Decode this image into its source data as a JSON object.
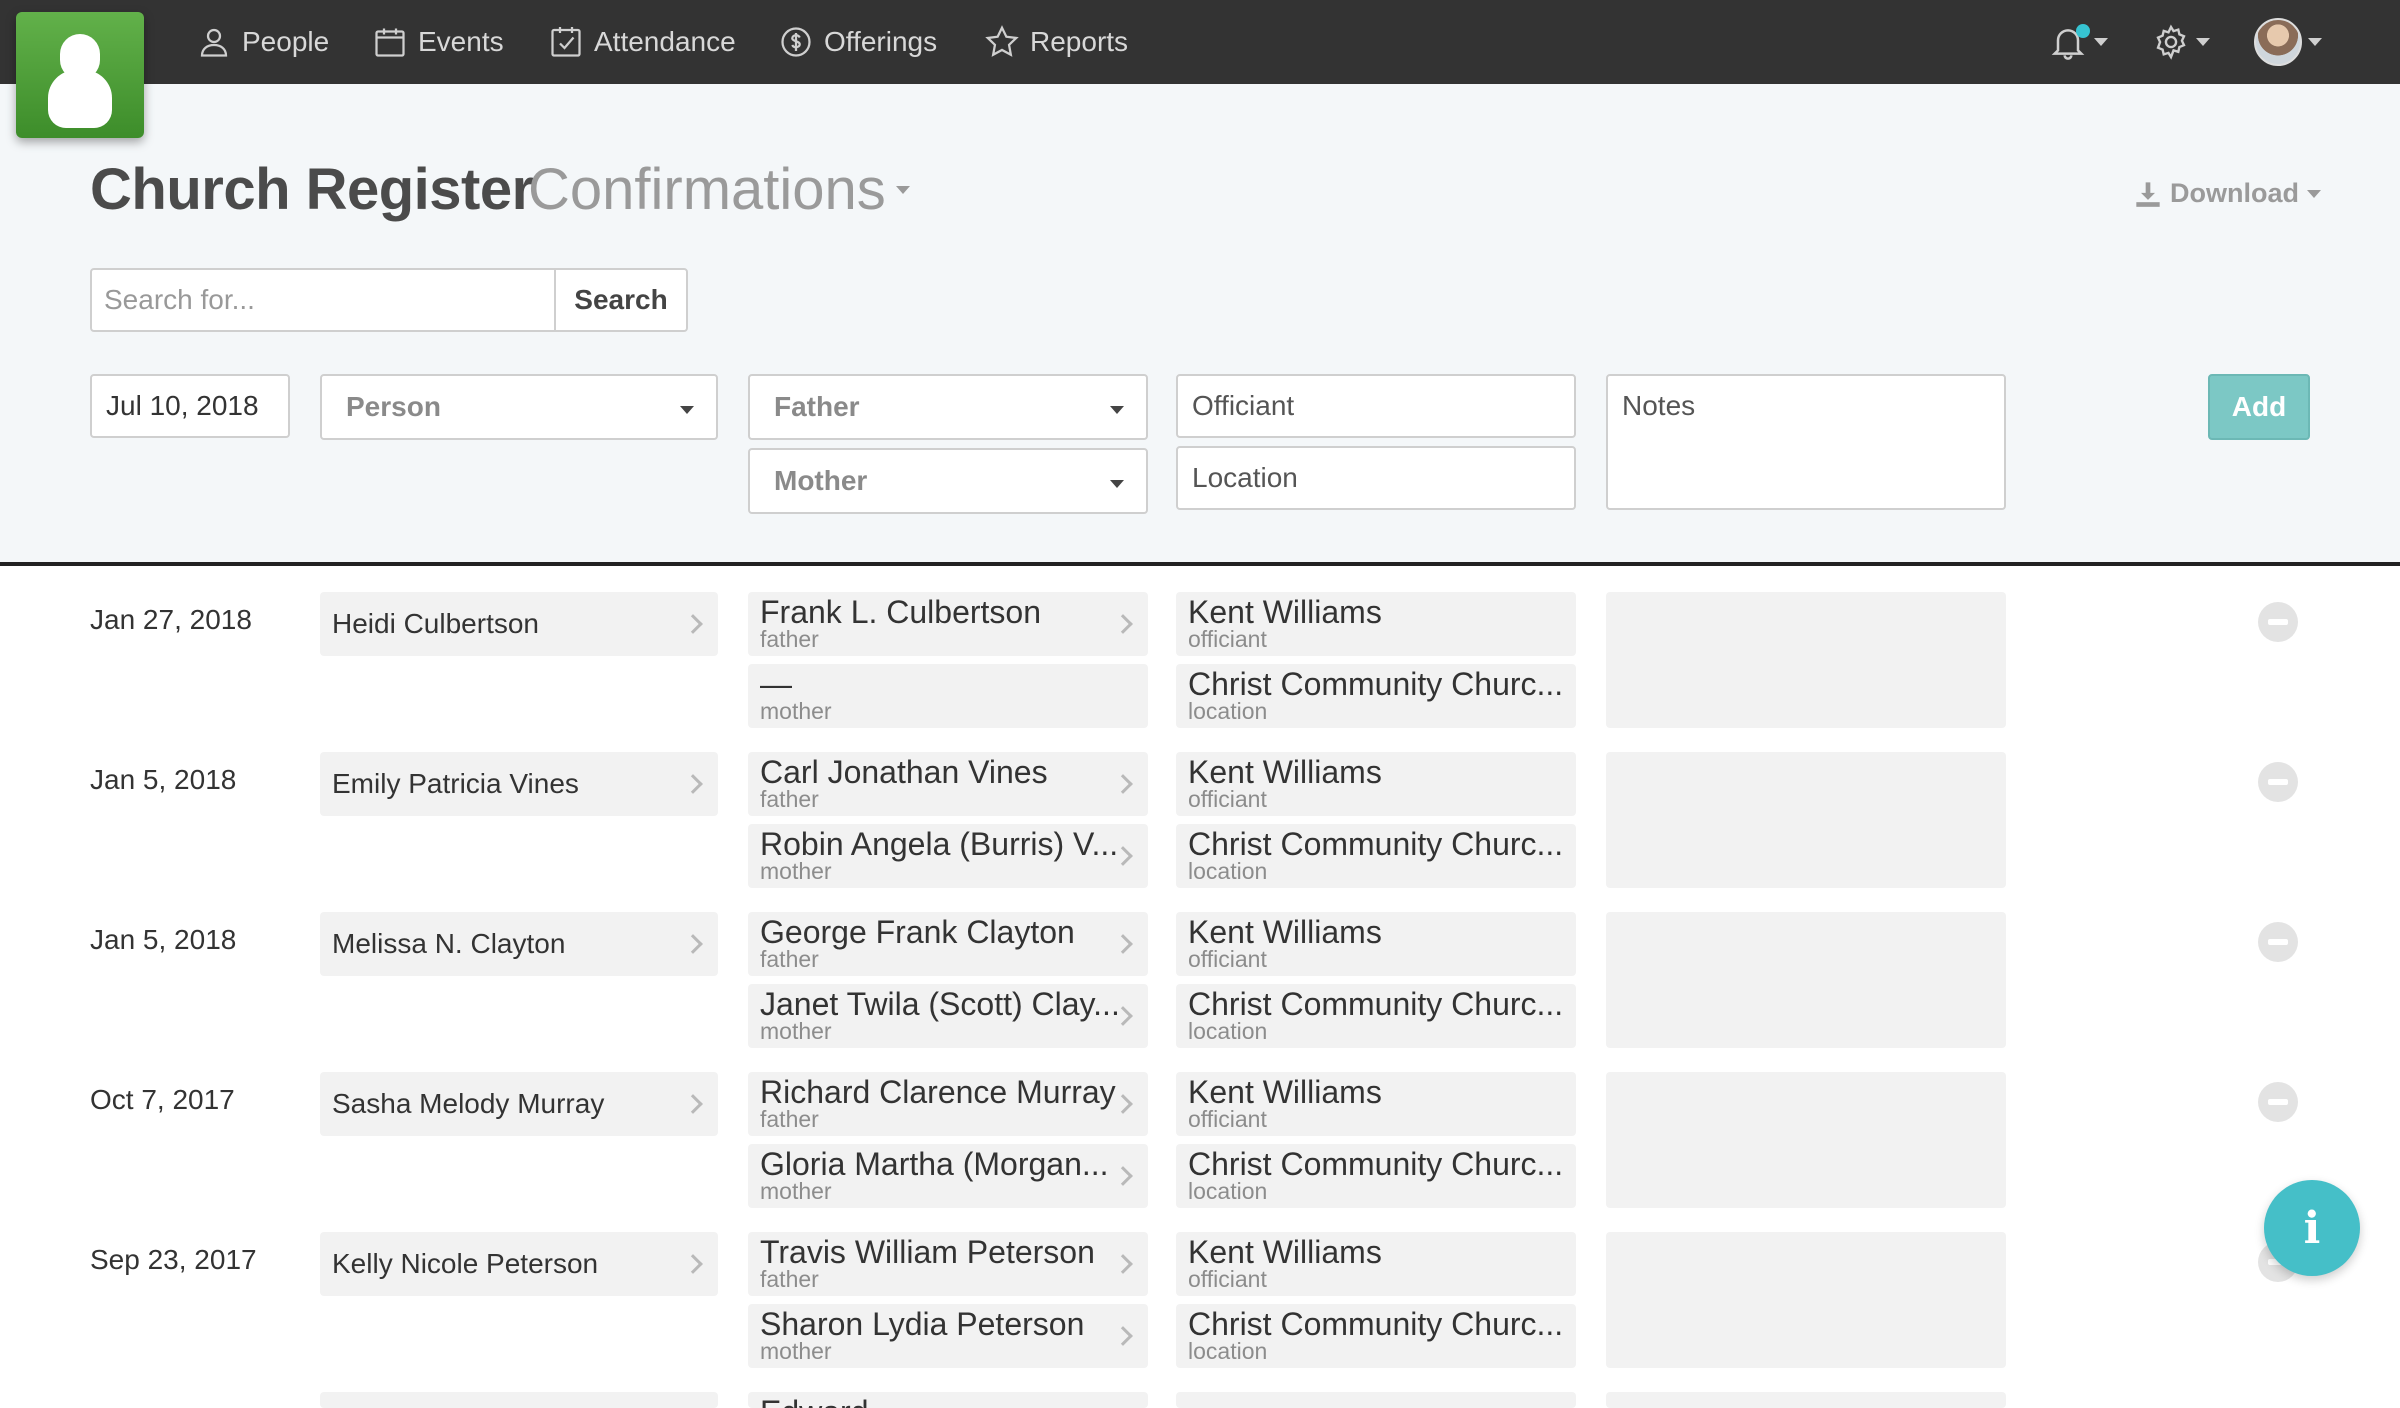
{
  "nav": {
    "items": [
      {
        "label": "People",
        "icon": "person-icon"
      },
      {
        "label": "Events",
        "icon": "calendar-icon"
      },
      {
        "label": "Attendance",
        "icon": "checkbox-icon"
      },
      {
        "label": "Offerings",
        "icon": "coin-icon"
      },
      {
        "label": "Reports",
        "icon": "star-icon"
      }
    ]
  },
  "header": {
    "title": "Church Register",
    "subtitle": "Confirmations",
    "download_label": "Download"
  },
  "search": {
    "placeholder": "Search for...",
    "button_label": "Search"
  },
  "form": {
    "date_value": "Jul 10, 2018",
    "person_label": "Person",
    "father_label": "Father",
    "mother_label": "Mother",
    "officiant_placeholder": "Officiant",
    "location_placeholder": "Location",
    "notes_placeholder": "Notes",
    "add_label": "Add"
  },
  "records": [
    {
      "date": "Jan 27, 2018",
      "person": "Heidi Culbertson",
      "father": "Frank L. Culbertson",
      "mother": "—",
      "officiant": "Kent Williams",
      "location": "Christ Community Churc..."
    },
    {
      "date": "Jan 5, 2018",
      "person": "Emily Patricia Vines",
      "father": "Carl Jonathan Vines",
      "mother": "Robin Angela (Burris) V...",
      "officiant": "Kent Williams",
      "location": "Christ Community Churc..."
    },
    {
      "date": "Jan 5, 2018",
      "person": "Melissa N. Clayton",
      "father": "George Frank Clayton",
      "mother": "Janet Twila (Scott) Clay...",
      "officiant": "Kent Williams",
      "location": "Christ Community Churc..."
    },
    {
      "date": "Oct 7, 2017",
      "person": "Sasha Melody Murray",
      "father": "Richard Clarence Murray",
      "mother": "Gloria Martha (Morgan...",
      "officiant": "Kent Williams",
      "location": "Christ Community Churc..."
    },
    {
      "date": "Sep 23, 2017",
      "person": "Kelly Nicole Peterson",
      "father": "Travis William Peterson",
      "mother": "Sharon Lydia Peterson",
      "officiant": "Kent Williams",
      "location": "Christ Community Churc..."
    }
  ],
  "partial_row": {
    "father": "Edward"
  },
  "role_labels": {
    "father": "father",
    "mother": "mother",
    "officiant": "officiant",
    "location": "location"
  },
  "info_button": "i"
}
